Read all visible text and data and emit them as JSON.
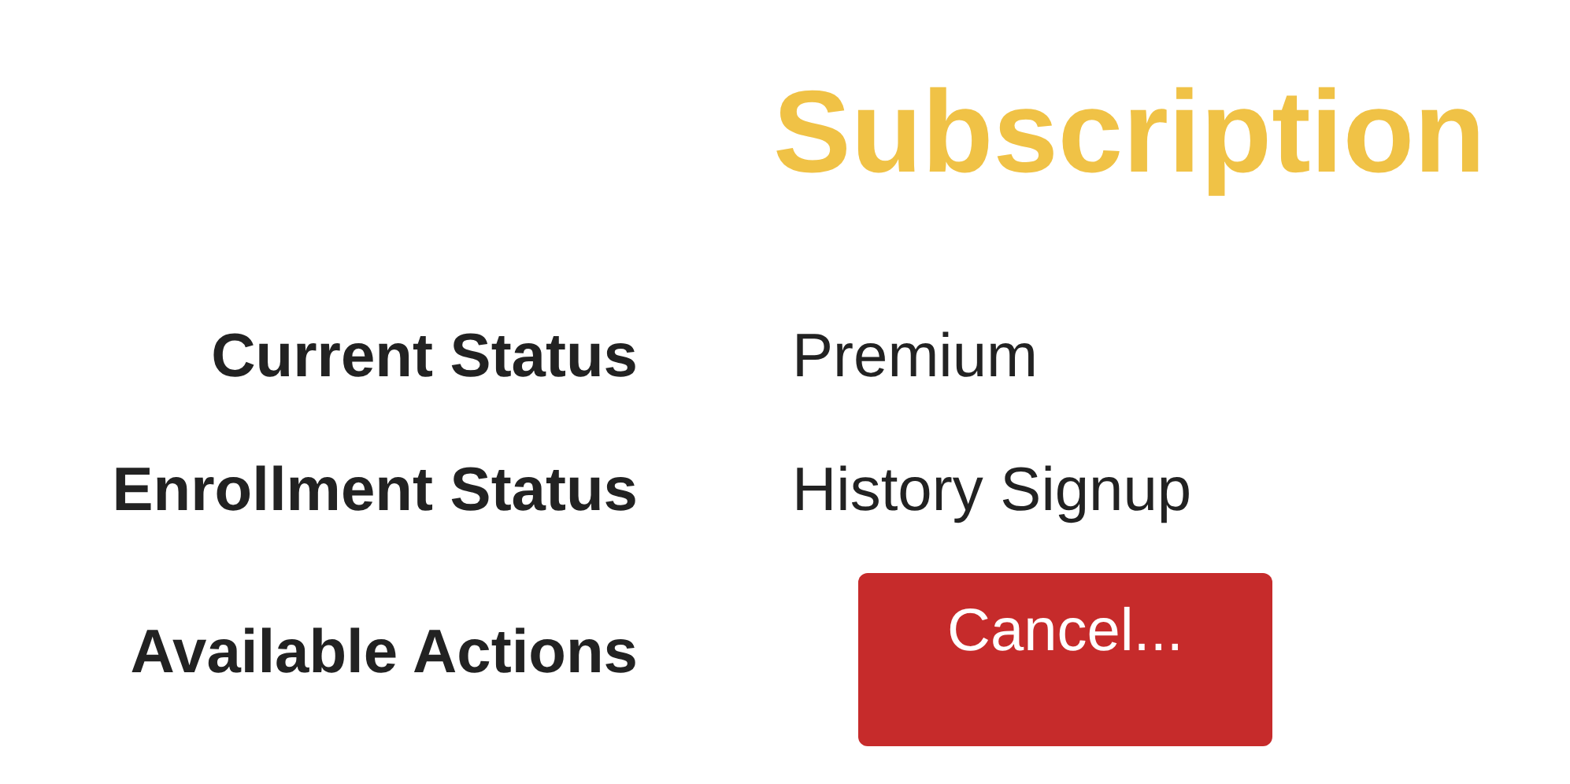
{
  "title": "Subscription",
  "fields": [
    {
      "kind": "text",
      "label": "Current Status",
      "value": "Premium"
    },
    {
      "kind": "text",
      "label": "Enrollment Status",
      "value": "History Signup"
    },
    {
      "kind": "actions",
      "label": "Available Actions",
      "actions": [
        "Cancel..."
      ]
    }
  ]
}
